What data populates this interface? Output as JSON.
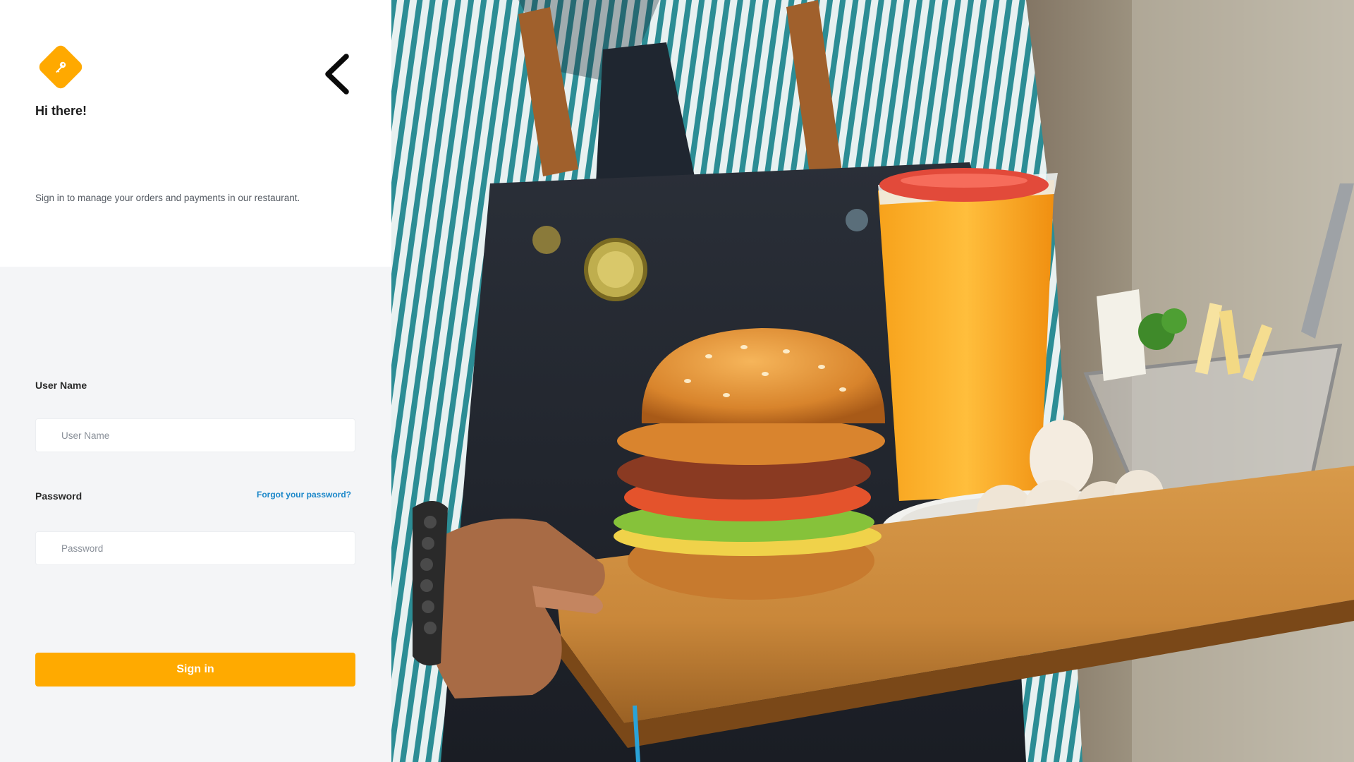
{
  "brand": {
    "logo_icon": "key-icon",
    "accent": "#ffaa00"
  },
  "header": {
    "greeting": "Hi there!",
    "subtitle": "Sign in to manage your orders and payments in our restaurant.",
    "back_icon": "chevron-left-icon"
  },
  "form": {
    "username_label": "User Name",
    "username_placeholder": "User Name",
    "username_value": "",
    "password_label": "Password",
    "password_placeholder": "Password",
    "password_value": "",
    "forgot_label": "Forgot your password?",
    "submit_label": "Sign in"
  },
  "colors": {
    "link": "#1b87c9",
    "panel_bg": "#f4f5f7",
    "card_bg": "#ffffff"
  }
}
